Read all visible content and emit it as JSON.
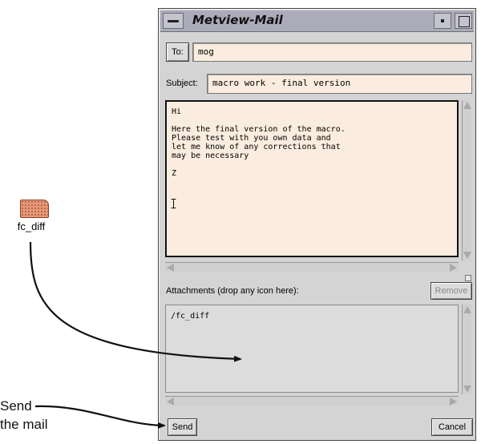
{
  "desktop_icon": {
    "label": "fc_diff",
    "color": "#e89a78"
  },
  "window": {
    "title": "Metview-Mail",
    "titlebar_color": "#ababb9",
    "to": {
      "button_label": "To:",
      "value": "mog"
    },
    "subject": {
      "label": "Subject:",
      "value": "macro work - final version"
    },
    "body_text": "Hi\n\nHere the final version of the macro.\nPlease test with you own data and\nlet me know of any corrections that\nmay be necessary\n\nZ",
    "attachments": {
      "label": "Attachments (drop any icon here):",
      "remove_label": "Remove",
      "items_text": "/fc_diff"
    },
    "send_label": "Send",
    "cancel_label": "Cancel",
    "field_color": "#faeddf"
  },
  "annotation": {
    "line1": "Send",
    "line2": "the mail"
  },
  "icons": [
    "window-menu-icon",
    "minimize-icon",
    "maximize-icon",
    "text-cursor-icon",
    "brick-file-icon"
  ]
}
